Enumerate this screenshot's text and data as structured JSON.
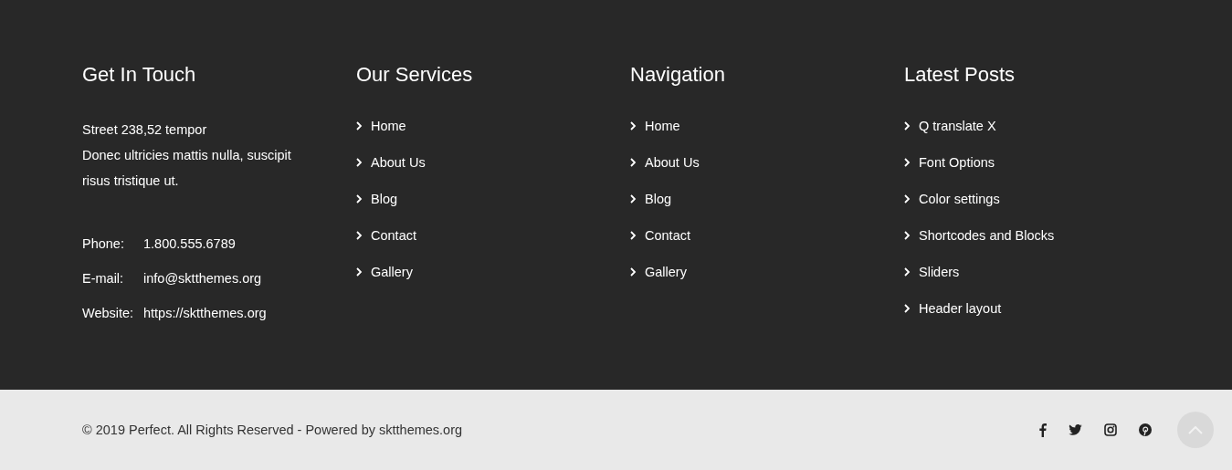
{
  "footer": {
    "contact": {
      "title": "Get In Touch",
      "address": [
        "Street 238,52 tempor",
        "Donec ultricies mattis nulla, suscipit risus tristique ut."
      ],
      "rows": [
        {
          "label": "Phone:",
          "value": "1.800.555.6789"
        },
        {
          "label": "E-mail:",
          "value": "info@sktthemes.org"
        },
        {
          "label": "Website:",
          "value": "https://sktthemes.org"
        }
      ]
    },
    "link_columns": [
      {
        "title": "Our Services",
        "links": [
          "Home",
          "About Us",
          "Blog",
          "Contact",
          "Gallery"
        ]
      },
      {
        "title": "Navigation",
        "links": [
          "Home",
          "About Us",
          "Blog",
          "Contact",
          "Gallery"
        ]
      },
      {
        "title": "Latest Posts",
        "links": [
          "Q translate X",
          "Font Options",
          "Color settings",
          "Shortcodes and Blocks",
          "Sliders",
          "Header layout"
        ]
      }
    ]
  },
  "bottom_bar": {
    "copyright": "© 2019 Perfect. All Rights Reserved - Powered by sktthemes.org",
    "social": [
      {
        "kind": "facebook"
      },
      {
        "kind": "twitter"
      },
      {
        "kind": "instagram"
      },
      {
        "kind": "pinterest"
      }
    ]
  }
}
